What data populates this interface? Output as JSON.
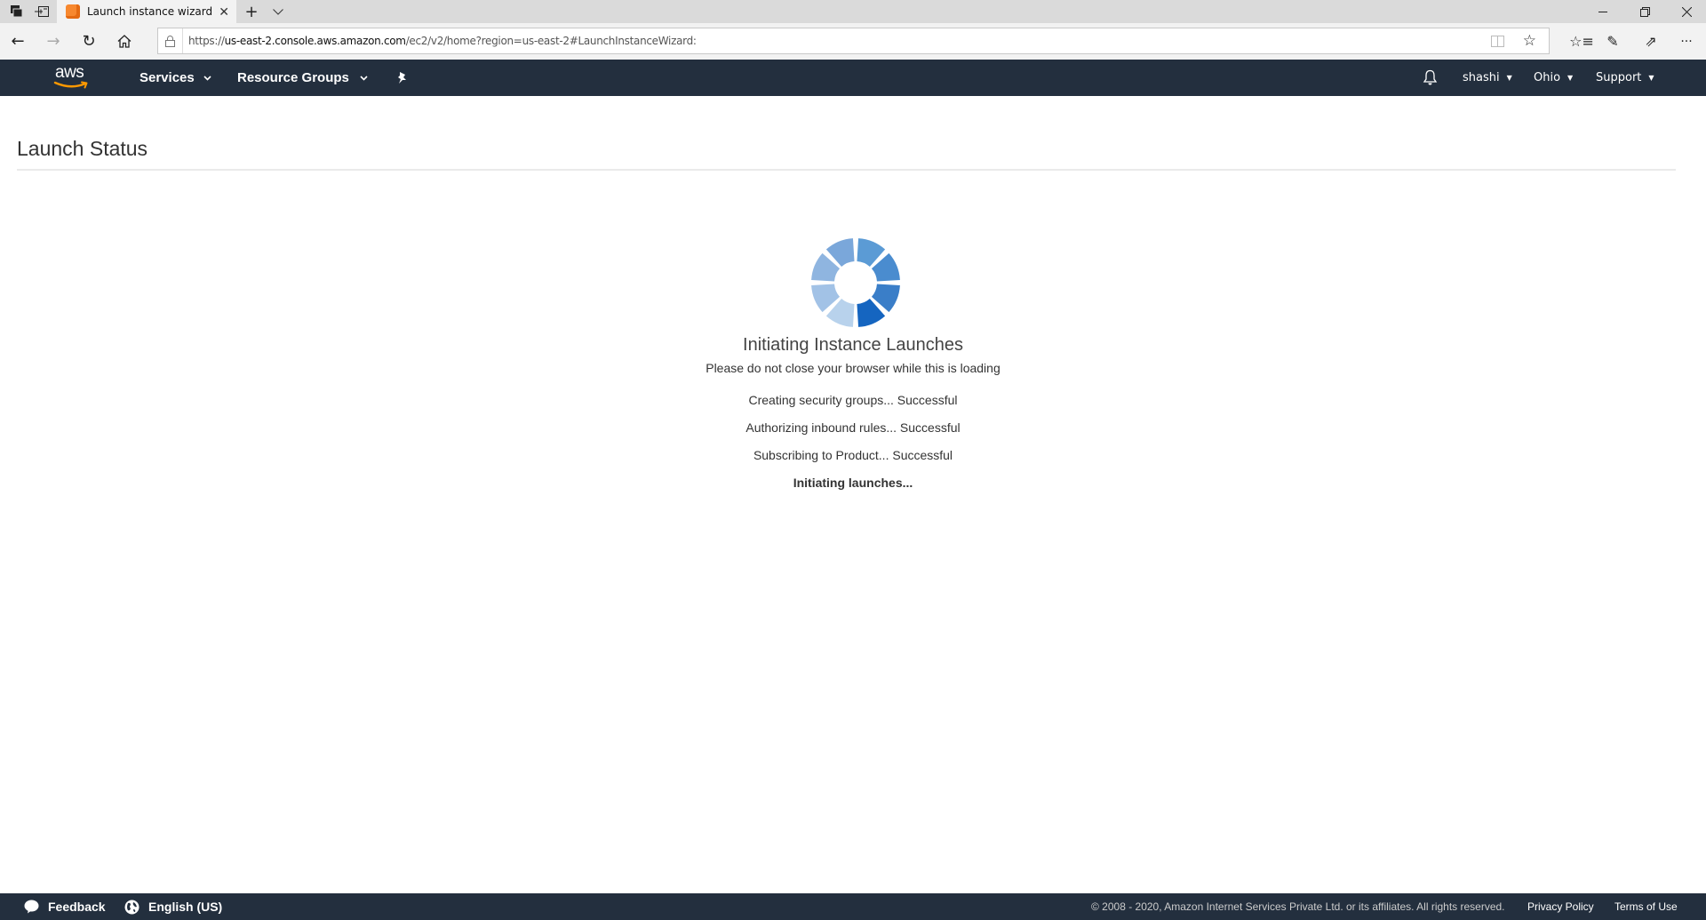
{
  "browser": {
    "tab_title": "Launch instance wizard",
    "url_prefix": "https://",
    "url_domain": "us-east-2.console.aws.amazon.com",
    "url_path": "/ec2/v2/home?region=us-east-2#LaunchInstanceWizard:",
    "icons": {
      "tab_actions": "tab-actions-icon",
      "set_aside": "set-aside-tabs-icon",
      "new_tab": "+",
      "tab_list": "⌄",
      "back": "←",
      "forward": "→",
      "refresh": "↻",
      "home": "⌂",
      "lock": "🔒",
      "reading_view": "▯",
      "favorite": "☆",
      "favorites_list": "☆≡",
      "notes": "✎",
      "share": "⇗",
      "more": "···",
      "minimize": "─",
      "restore": "❐",
      "close": "✕"
    }
  },
  "nav": {
    "logo_text": "aws",
    "services_label": "Services",
    "resource_groups_label": "Resource Groups",
    "user_label": "shashi",
    "region_label": "Ohio",
    "support_label": "Support",
    "caret": "▼",
    "menu_caret": "⌄"
  },
  "page": {
    "title": "Launch Status",
    "heading": "Initiating Instance Launches",
    "subheading": "Please do not close your browser while this is loading",
    "steps": [
      {
        "label": "Creating security groups... Successful",
        "status": "done"
      },
      {
        "label": "Authorizing inbound rules... Successful",
        "status": "done"
      },
      {
        "label": "Subscribing to Product... Successful",
        "status": "done"
      },
      {
        "label": "Initiating launches...",
        "status": "in-progress"
      }
    ],
    "spinner_colors": [
      "#5b9bd5",
      "#4a8ccf",
      "#3a7ec8",
      "#1565c0",
      "#b8d2ec",
      "#a2c2e6",
      "#8fb5e0",
      "#7aa7da"
    ]
  },
  "footer": {
    "feedback_label": "Feedback",
    "language_label": "English (US)",
    "copyright": "© 2008 - 2020, Amazon Internet Services Private Ltd. or its affiliates. All rights reserved.",
    "privacy_label": "Privacy Policy",
    "terms_label": "Terms of Use"
  },
  "colors": {
    "nav_bg": "#232f3e",
    "aws_orange": "#ff9900"
  }
}
